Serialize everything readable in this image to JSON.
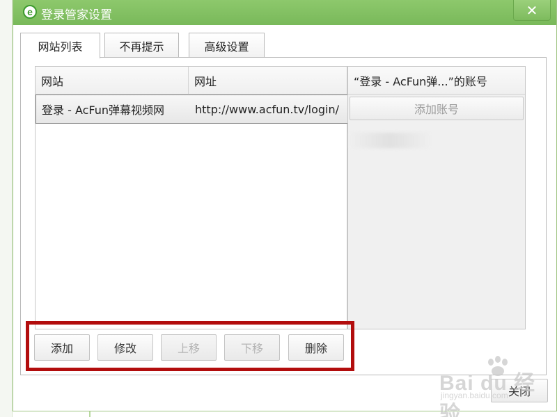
{
  "window": {
    "title": "登录管家设置",
    "close_glyph": "✕",
    "app_icon_letter": "e"
  },
  "tabs": [
    {
      "label": "网站列表",
      "active": true
    },
    {
      "label": "不再提示",
      "active": false
    },
    {
      "label": "高级设置",
      "active": false
    }
  ],
  "site_table": {
    "columns": [
      "网站",
      "网址"
    ],
    "rows": [
      {
        "site": "登录 - AcFun弹幕视频网",
        "url": "http://www.acfun.tv/login/"
      }
    ]
  },
  "account_panel": {
    "header": "“登录 - AcFun弹...”的账号",
    "add_account_label": "添加账号"
  },
  "actions": {
    "add": "添加",
    "edit": "修改",
    "move_up": "上移",
    "move_down": "下移",
    "delete": "删除"
  },
  "footer": {
    "close_label": "关闭"
  },
  "watermark": {
    "main": "Bai du 经验",
    "sub": "jingyan.baidu.com"
  },
  "colors": {
    "titlebar": "#7dbb5d",
    "highlight_border": "#b20d0d"
  }
}
